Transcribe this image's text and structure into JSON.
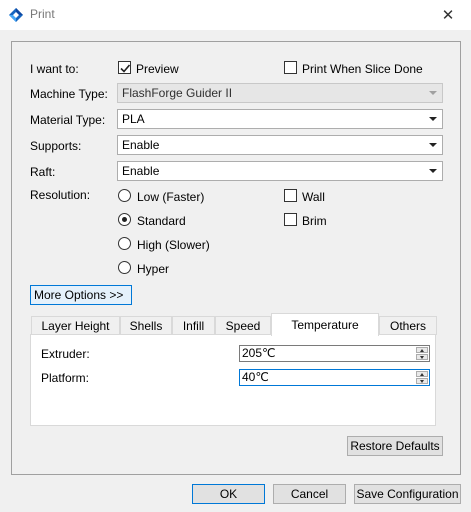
{
  "window": {
    "title": "Print",
    "close_glyph": "✕",
    "icon": "flashforge-diamond-icon"
  },
  "form": {
    "i_want_to": {
      "label": "I want to:",
      "preview": {
        "label": "Preview",
        "checked": true
      },
      "print_when_slice_done": {
        "label": "Print When Slice Done",
        "checked": false
      }
    },
    "machine_type": {
      "label": "Machine Type:",
      "value": "FlashForge Guider II",
      "disabled": true
    },
    "material_type": {
      "label": "Material Type:",
      "value": "PLA"
    },
    "supports": {
      "label": "Supports:",
      "value": "Enable"
    },
    "raft": {
      "label": "Raft:",
      "value": "Enable"
    },
    "resolution": {
      "label": "Resolution:",
      "options": [
        "Low (Faster)",
        "Standard",
        "High (Slower)",
        "Hyper"
      ],
      "selected": "Standard"
    },
    "wall": {
      "label": "Wall",
      "checked": false
    },
    "brim": {
      "label": "Brim",
      "checked": false
    }
  },
  "more_options": {
    "label": "More Options >>"
  },
  "tabs": {
    "items": [
      "Layer Height",
      "Shells",
      "Infill",
      "Speed",
      "Temperature",
      "Others"
    ],
    "active": "Temperature"
  },
  "temperature": {
    "extruder": {
      "label": "Extruder:",
      "value": "205℃"
    },
    "platform": {
      "label": "Platform:",
      "value": "40℃"
    }
  },
  "buttons": {
    "restore_defaults": "Restore Defaults",
    "ok": "OK",
    "cancel": "Cancel",
    "save_configuration": "Save Configuration"
  },
  "colors": {
    "accent": "#0078d7",
    "brand": "#1565c0"
  }
}
